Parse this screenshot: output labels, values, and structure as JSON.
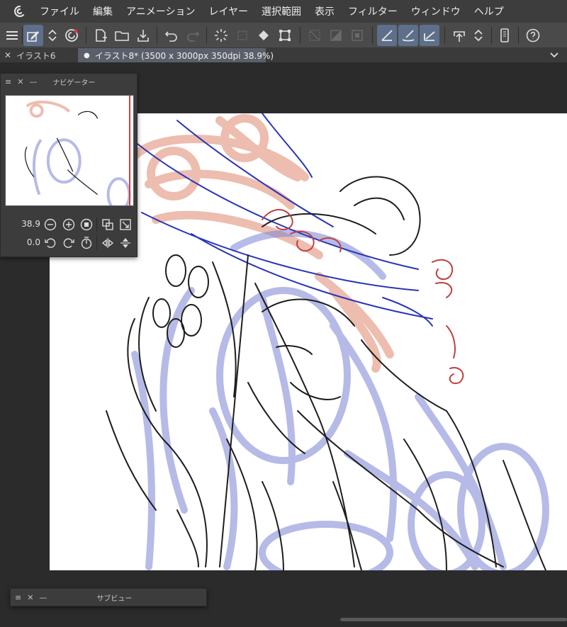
{
  "menubar": {
    "logo_icon": "clip-studio-logo-icon",
    "items": [
      "ファイル",
      "編集",
      "アニメーション",
      "レイヤー",
      "選択範囲",
      "表示",
      "フィルター",
      "ウィンドウ",
      "ヘルプ"
    ]
  },
  "tabs": [
    {
      "label": "イラスト6",
      "active": false
    },
    {
      "label": "イラスト8* (3500 x 3000px 350dpi 38.9%)",
      "active": true
    }
  ],
  "navigator": {
    "title": "ナビゲーター",
    "zoom_value": "38.9",
    "rotate_value": "0.0"
  },
  "subview": {
    "title": "サブビュー"
  },
  "colors": {
    "accent": "#5d6f8a",
    "sketch_black": "#1e1e1e",
    "sketch_blue": "#6b73c9",
    "sketch_dark_blue": "#2a35b8",
    "sketch_pink": "#e6a28e",
    "sketch_red": "#c0403e"
  }
}
